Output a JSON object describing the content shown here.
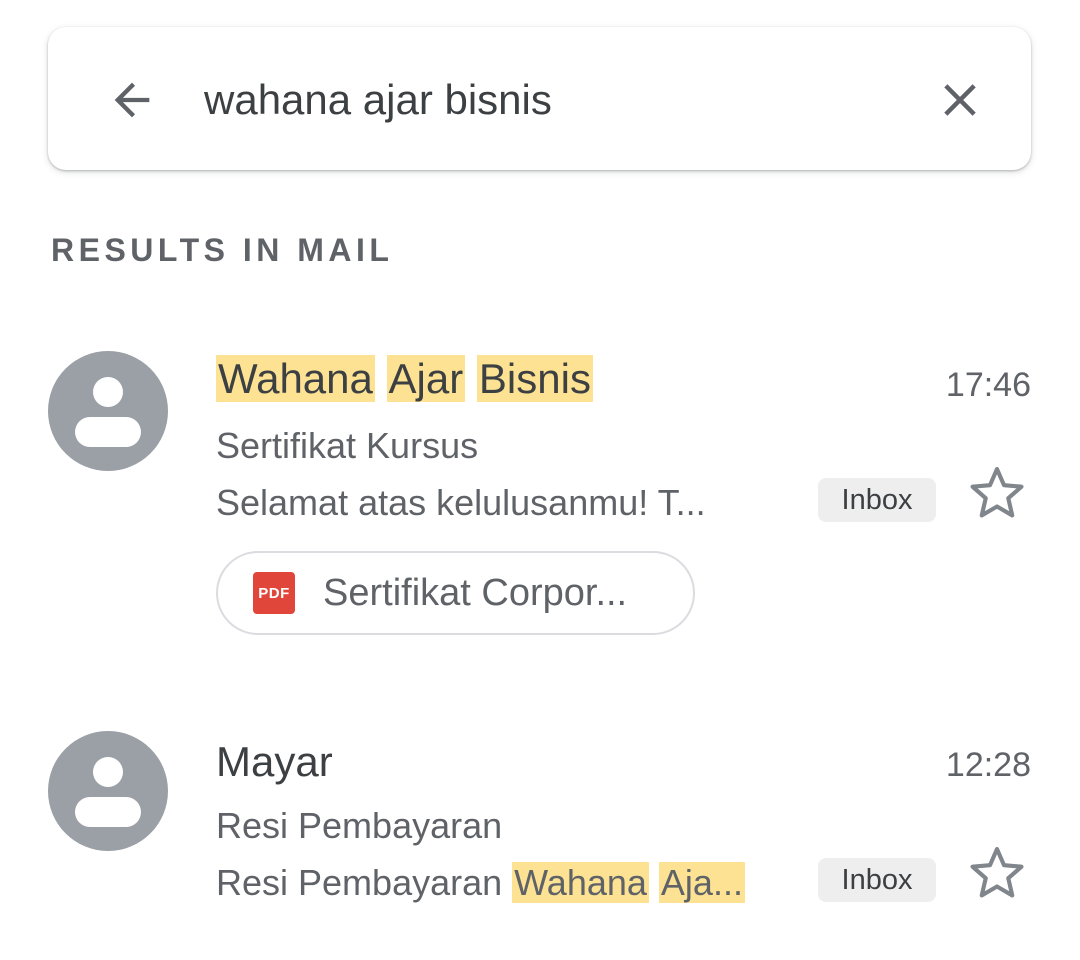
{
  "search": {
    "query": "wahana ajar bisnis",
    "back_icon": "arrow-left-icon",
    "clear_icon": "close-icon"
  },
  "section_label": "RESULTS IN MAIL",
  "colors": {
    "highlight": "#fde293",
    "avatar": "#9aa0a6",
    "pdf": "#e0463a"
  },
  "emails": [
    {
      "sender_parts": [
        "Wahana",
        "Ajar",
        "Bisnis"
      ],
      "time": "17:46",
      "subject": "Sertifikat Kursus",
      "snippet": "Selamat atas kelulusanmu! T...",
      "label": "Inbox",
      "starred": false,
      "attachment": {
        "type": "PDF",
        "name": "Sertifikat Corpor..."
      }
    },
    {
      "sender": "Mayar",
      "time": "12:28",
      "subject": "Resi Pembayaran",
      "snippet_prefix": "Resi Pembayaran",
      "snippet_hl1": "Wahana",
      "snippet_hl2": "Aja...",
      "label": "Inbox",
      "starred": false
    }
  ]
}
